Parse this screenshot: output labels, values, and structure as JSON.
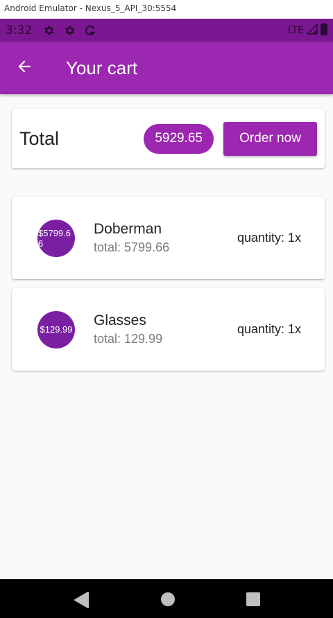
{
  "window": {
    "title": "Android Emulator - Nexus_5_API_30:5554"
  },
  "status_bar": {
    "time": "3:32",
    "network": "LTE"
  },
  "app_bar": {
    "title": "Your cart"
  },
  "summary": {
    "label": "Total",
    "amount": "5929.65",
    "order_button": "Order now"
  },
  "items": [
    {
      "avatar_text": "$5799.66",
      "name": "Doberman",
      "total": "total: 5799.66",
      "quantity": "quantity: 1x"
    },
    {
      "avatar_text": "$129.99",
      "name": "Glasses",
      "total": "total: 129.99",
      "quantity": "quantity: 1x"
    }
  ],
  "colors": {
    "primary": "#9c27b0",
    "status_bar": "#7b1791",
    "avatar": "#7b1fa2"
  }
}
